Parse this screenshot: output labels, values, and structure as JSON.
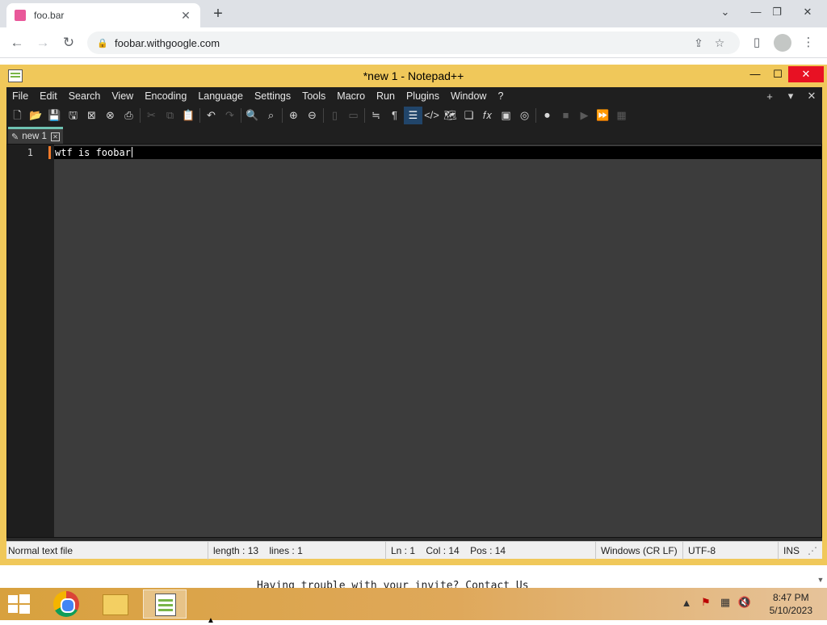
{
  "browser": {
    "tab_title": "foo.bar",
    "tab_close": "✕",
    "new_tab": "+",
    "url": "foobar.withgoogle.com",
    "tab_search": "⌄",
    "minimize": "—",
    "restore": "❐",
    "close": "✕",
    "back": "←",
    "forward": "→",
    "reload": "↻",
    "share": "⇪",
    "bookmark": "☆",
    "side_panel": "▯",
    "menu": "⋮"
  },
  "page": {
    "text": "Having trouble with your invite? Contact Us"
  },
  "notepadpp": {
    "title": "*new 1 - Notepad++",
    "minimize": "—",
    "maximize": "☐",
    "close": "✕",
    "menu": [
      "File",
      "Edit",
      "Search",
      "View",
      "Encoding",
      "Language",
      "Settings",
      "Tools",
      "Macro",
      "Run",
      "Plugins",
      "Window",
      "?"
    ],
    "menu_right": {
      "add": "+",
      "dropdown": "▾",
      "close": "✕"
    },
    "toolbar_icons": [
      "new-file",
      "open-file",
      "save",
      "save-all",
      "close",
      "close-all",
      "print",
      "cut",
      "copy",
      "paste",
      "undo",
      "redo",
      "find",
      "replace",
      "zoom-in",
      "zoom-out",
      "sync-vertical",
      "sync-horizontal",
      "word-wrap",
      "show-all-chars",
      "indent-guide",
      "language-xml",
      "document-map",
      "document-list",
      "function-list",
      "folder-as-workspace",
      "monitoring",
      "record-macro",
      "stop-record",
      "play-macro",
      "run-macro-multiple",
      "save-macro"
    ],
    "doc_tab": {
      "label": "new 1",
      "close": "✕",
      "icon": "✎"
    },
    "editor": {
      "line_number": "1",
      "line_text": "wtf is foobar"
    },
    "status": {
      "file_type": "Normal text file",
      "length": "length : 13",
      "lines": "lines : 1",
      "ln": "Ln : 1",
      "col": "Col : 14",
      "pos": "Pos : 14",
      "eol": "Windows (CR LF)",
      "encoding": "UTF-8",
      "mode": "INS",
      "grip": "⋰"
    }
  },
  "taskbar": {
    "apps": [
      "chrome",
      "file-explorer",
      "notepadpp"
    ],
    "tray": {
      "expand": "▲",
      "flag": "⚑",
      "network": "▦",
      "volume": "🔇"
    },
    "time": "8:47 PM",
    "date": "5/10/2023"
  }
}
